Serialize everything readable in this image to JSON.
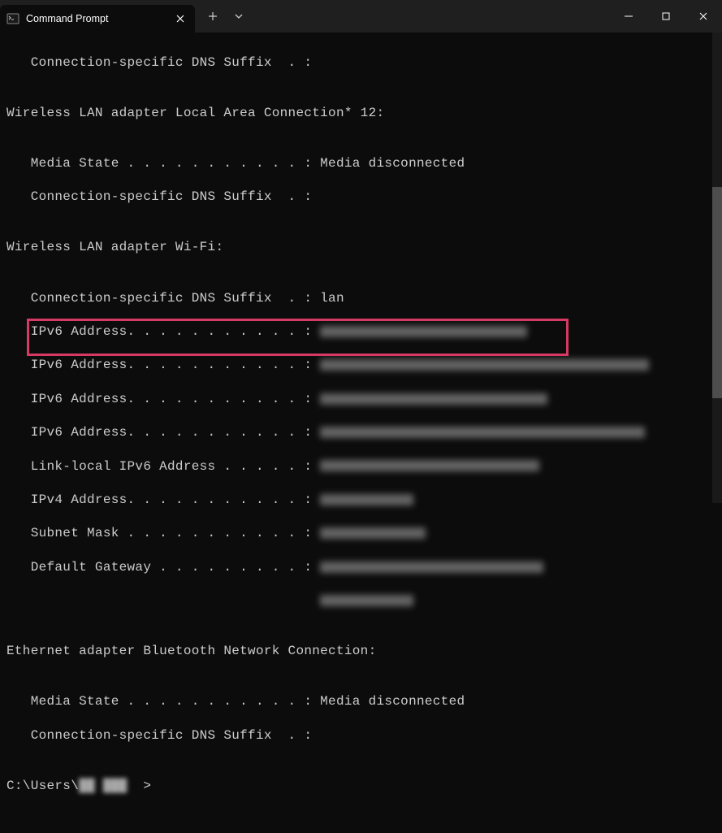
{
  "titlebar": {
    "tab_title": "Command Prompt"
  },
  "terminal": {
    "line1": "   Connection-specific DNS Suffix  . :",
    "blank1": "",
    "adapter1": "Wireless LAN adapter Local Area Connection* 12:",
    "blank2": "",
    "adapter1_media": "   Media State . . . . . . . . . . . : Media disconnected",
    "adapter1_dns": "   Connection-specific DNS Suffix  . :",
    "blank3": "",
    "adapter2": "Wireless LAN adapter Wi-Fi:",
    "blank4": "",
    "wifi_dns": "   Connection-specific DNS Suffix  . : lan",
    "wifi_ipv6_1_label": "   IPv6 Address. . . . . . . . . . . : ",
    "wifi_ipv6_2_label": "   IPv6 Address. . . . . . . . . . . : ",
    "wifi_ipv6_3_label": "   IPv6 Address. . . . . . . . . . . : ",
    "wifi_ipv6_4_label": "   IPv6 Address. . . . . . . . . . . : ",
    "wifi_linklocal_label": "   Link-local IPv6 Address . . . . . : ",
    "wifi_ipv4_label": "   IPv4 Address. . . . . . . . . . . : ",
    "wifi_subnet_label": "   Subnet Mask . . . . . . . . . . . : ",
    "wifi_gateway_label": "   Default Gateway . . . . . . . . . : ",
    "wifi_gateway_line2_prefix": "                                       ",
    "blank5": "",
    "adapter3": "Ethernet adapter Bluetooth Network Connection:",
    "blank6": "",
    "bt_media": "   Media State . . . . . . . . . . . : Media disconnected",
    "bt_dns": "   Connection-specific DNS Suffix  . :",
    "blank7": "",
    "prompt_prefix": "C:\\Users\\",
    "prompt_suffix": ">"
  }
}
